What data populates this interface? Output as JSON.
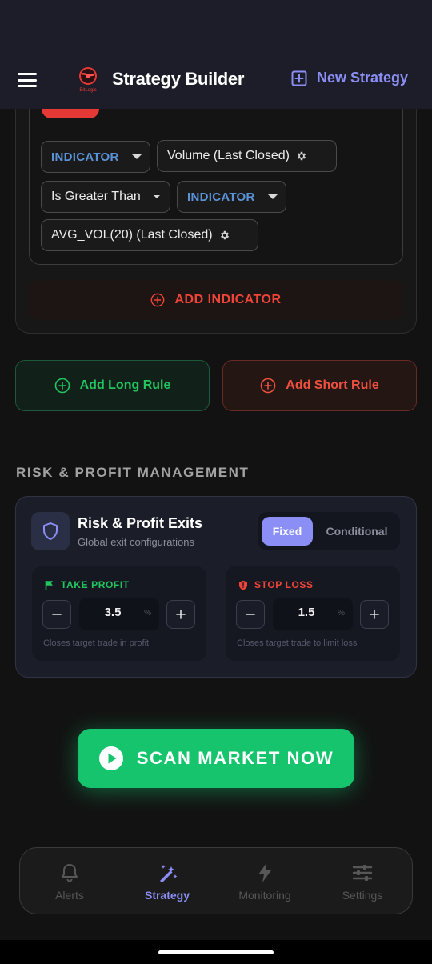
{
  "header": {
    "title": "Strategy Builder",
    "new_strategy_label": "New Strategy",
    "logo_text": "BitLogic"
  },
  "rule": {
    "row1": {
      "left_type": "INDICATOR",
      "left_value": "Volume (Last Closed)"
    },
    "row2": {
      "operator": "Is Greater Than",
      "right_type": "INDICATOR"
    },
    "row3": {
      "right_value": "AVG_VOL(20) (Last Closed)"
    },
    "add_indicator_label": "ADD INDICATOR"
  },
  "rule_buttons": {
    "long_label": "Add Long Rule",
    "short_label": "Add Short Rule"
  },
  "risk": {
    "section_title": "RISK & PROFIT MANAGEMENT",
    "card_title": "Risk & Profit Exits",
    "card_subtitle": "Global exit configurations",
    "toggle": {
      "fixed_label": "Fixed",
      "conditional_label": "Conditional",
      "selected": "Fixed"
    },
    "take_profit": {
      "label": "TAKE PROFIT",
      "value": "3.5",
      "unit": "%",
      "hint": "Closes target trade in profit"
    },
    "stop_loss": {
      "label": "STOP LOSS",
      "value": "1.5",
      "unit": "%",
      "hint": "Closes target trade to limit loss"
    }
  },
  "scan_button_label": "SCAN MARKET NOW",
  "nav": {
    "items": [
      {
        "label": "Alerts",
        "icon": "bell-icon"
      },
      {
        "label": "Strategy",
        "icon": "magic-wand-icon"
      },
      {
        "label": "Monitoring",
        "icon": "bolt-icon"
      },
      {
        "label": "Settings",
        "icon": "sliders-icon"
      }
    ],
    "active": "Strategy"
  },
  "colors": {
    "accent": "#8b8ff5",
    "indicator_blue": "#5b93d9",
    "green": "#22c55e",
    "red": "#f04438",
    "scan_green": "#16c46e"
  }
}
